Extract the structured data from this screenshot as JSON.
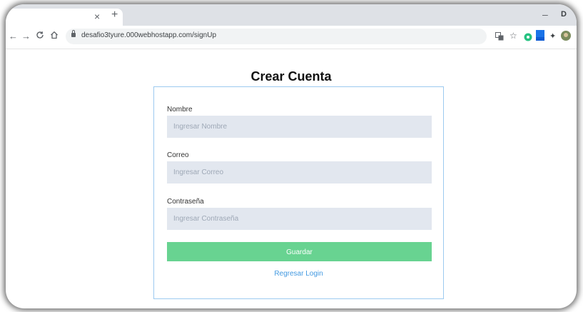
{
  "browser": {
    "tab_title": "",
    "tab_close": "×",
    "new_tab": "+",
    "window_minimize": "–",
    "window_max": "D",
    "url": "desafio3tyure.000webhostapp.com/signUp"
  },
  "page": {
    "title": "Crear Cuenta",
    "form": {
      "nombre": {
        "label": "Nombre",
        "placeholder": "Ingresar Nombre",
        "value": ""
      },
      "correo": {
        "label": "Correo",
        "placeholder": "Ingresar Correo",
        "value": ""
      },
      "contrasena": {
        "label": "Contraseña",
        "placeholder": "Ingresar Contraseña",
        "value": ""
      },
      "submit_label": "Guardar",
      "back_link": "Regresar Login"
    }
  },
  "colors": {
    "button": "#68d391",
    "link": "#4299e1",
    "field_bg": "#e2e7ef",
    "card_border": "#9ccaf0"
  },
  "icons": [
    "back-arrow-icon",
    "forward-arrow-icon",
    "reload-icon",
    "home-icon",
    "lock-icon",
    "translate-icon",
    "star-icon",
    "extension-icon",
    "puzzle-icon",
    "profile-avatar-icon",
    "menu-icon"
  ]
}
